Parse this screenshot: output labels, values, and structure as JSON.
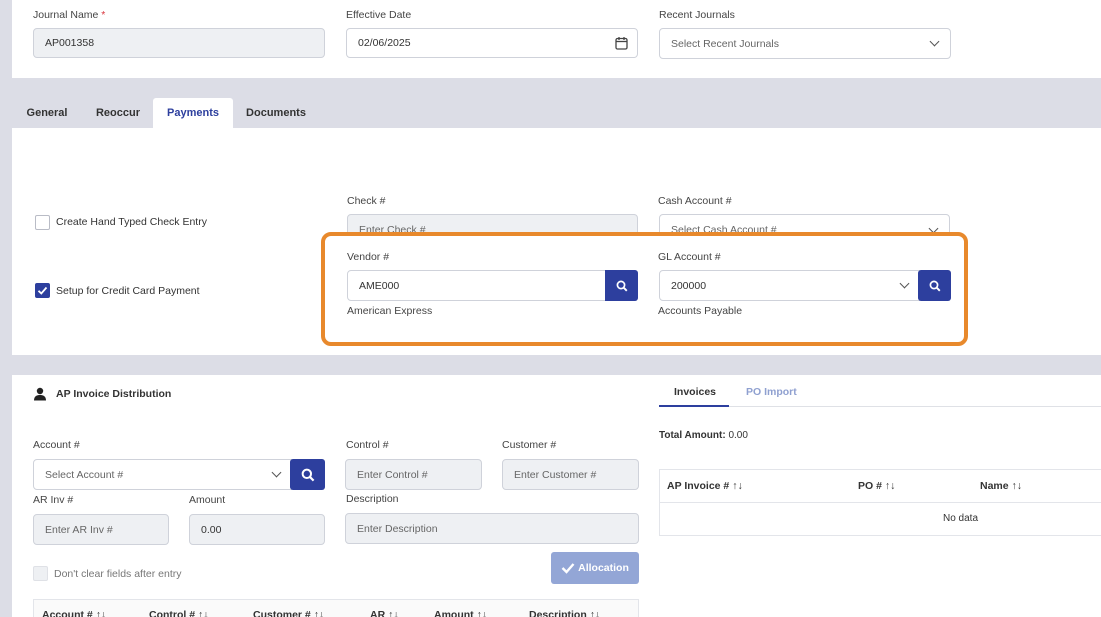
{
  "header": {
    "journal_name_label": "Journal Name",
    "journal_name_required": "*",
    "journal_name_value": "AP001358",
    "effective_date_label": "Effective Date",
    "effective_date_value": "02/06/2025",
    "recent_journals_label": "Recent Journals",
    "recent_journals_placeholder": "Select Recent Journals"
  },
  "tabs": [
    {
      "label": "General"
    },
    {
      "label": "Reoccur"
    },
    {
      "label": "Payments",
      "active": true
    },
    {
      "label": "Documents"
    }
  ],
  "payments": {
    "hand_check_label": "Create Hand Typed Check Entry",
    "hand_check_checked": false,
    "credit_card_label": "Setup for Credit Card Payment",
    "credit_card_checked": true,
    "check_label": "Check #",
    "check_placeholder": "Enter Check #",
    "cash_account_label": "Cash Account #",
    "cash_account_placeholder": "Select Cash Account #",
    "vendor_label": "Vendor #",
    "vendor_value": "AME000",
    "vendor_name": "American Express",
    "gl_account_label": "GL Account #",
    "gl_account_value": "200000",
    "gl_account_name": "Accounts Payable",
    "highlight_color": "#e8892c"
  },
  "distribution": {
    "title": "AP Invoice Distribution",
    "account_label": "Account #",
    "account_placeholder": "Select Account #",
    "control_label": "Control #",
    "control_placeholder": "Enter Control #",
    "customer_label": "Customer #",
    "customer_placeholder": "Enter Customer #",
    "ar_inv_label": "AR Inv #",
    "ar_inv_placeholder": "Enter AR Inv #",
    "amount_label": "Amount",
    "amount_value": "0.00",
    "description_label": "Description",
    "description_placeholder": "Enter Description",
    "dont_clear_label": "Don't clear fields after entry",
    "allocation_label": "Allocation",
    "columns": [
      "Account #",
      "Control #",
      "Customer #",
      "AR",
      "Amount",
      "Description"
    ]
  },
  "invoices": {
    "tabs": [
      {
        "label": "Invoices",
        "active": true
      },
      {
        "label": "PO Import"
      }
    ],
    "total_label": "Total Amount:",
    "total_value": "0.00",
    "columns": [
      "AP Invoice #",
      "PO #",
      "Name"
    ],
    "empty_text": "No data"
  },
  "colors": {
    "primary": "#2d3f9e",
    "accent_tab": "#2d3f9e",
    "allocation_bg": "#93a6d6"
  }
}
